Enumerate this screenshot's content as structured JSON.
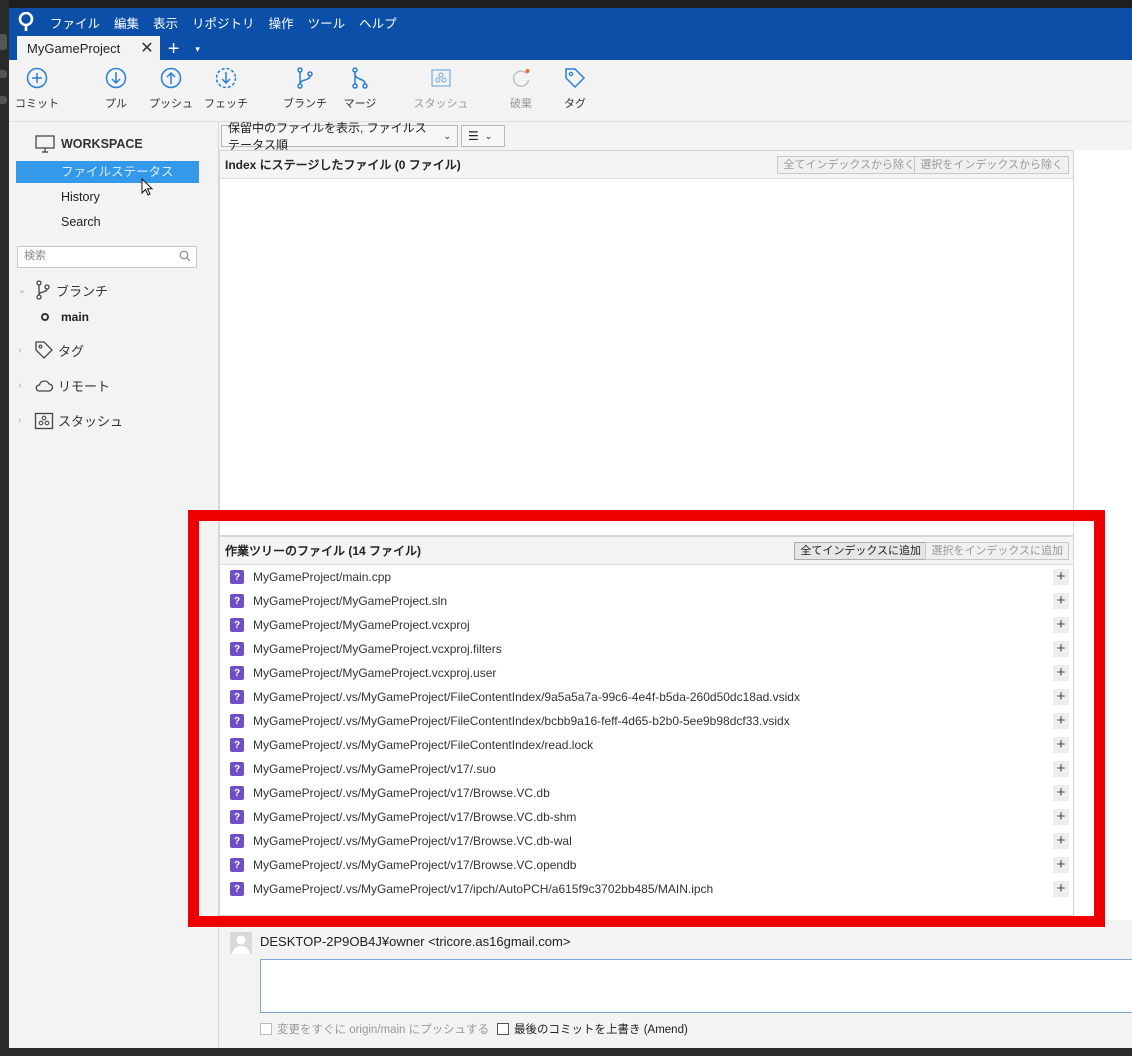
{
  "menubar": {
    "items": [
      "ファイル",
      "編集",
      "表示",
      "リポジトリ",
      "操作",
      "ツール",
      "ヘルプ"
    ]
  },
  "tabbar": {
    "tab_label": "MyGameProject",
    "close_glyph": "✕",
    "plus_glyph": "+",
    "caret_glyph": "▾"
  },
  "toolbar": {
    "commit": "コミット",
    "pull": "プル",
    "push": "プッシュ",
    "fetch": "フェッチ",
    "branch": "ブランチ",
    "merge": "マージ",
    "stash": "スタッシュ",
    "discard": "破棄",
    "tag": "タグ"
  },
  "sidebar": {
    "workspace": "WORKSPACE",
    "nav": [
      "ファイルステータス",
      "History",
      "Search"
    ],
    "search_placeholder": "検索",
    "branches": "ブランチ",
    "main_branch": "main",
    "tags": "タグ",
    "remotes": "リモート",
    "stashes": "スタッシュ"
  },
  "filterbar": {
    "dropdown": "保留中のファイルを表示, ファイルステータス順",
    "view_glyph": "☰"
  },
  "staged": {
    "title": "Index にステージしたファイル   (0 ファイル)",
    "remove_all": "全てインデックスから除く",
    "remove_selected": "選択をインデックスから除く"
  },
  "unstaged": {
    "title": "作業ツリーのファイル   (14 ファイル)",
    "add_all": "全てインデックスに追加",
    "add_selected": "選択をインデックスに追加",
    "files": [
      "MyGameProject/main.cpp",
      "MyGameProject/MyGameProject.sln",
      "MyGameProject/MyGameProject.vcxproj",
      "MyGameProject/MyGameProject.vcxproj.filters",
      "MyGameProject/MyGameProject.vcxproj.user",
      "MyGameProject/.vs/MyGameProject/FileContentIndex/9a5a5a7a-99c6-4e4f-b5da-260d50dc18ad.vsidx",
      "MyGameProject/.vs/MyGameProject/FileContentIndex/bcbb9a16-feff-4d65-b2b0-5ee9b98dcf33.vsidx",
      "MyGameProject/.vs/MyGameProject/FileContentIndex/read.lock",
      "MyGameProject/.vs/MyGameProject/v17/.suo",
      "MyGameProject/.vs/MyGameProject/v17/Browse.VC.db",
      "MyGameProject/.vs/MyGameProject/v17/Browse.VC.db-shm",
      "MyGameProject/.vs/MyGameProject/v17/Browse.VC.db-wal",
      "MyGameProject/.vs/MyGameProject/v17/Browse.VC.opendb",
      "MyGameProject/.vs/MyGameProject/v17/ipch/AutoPCH/a615f9c3702bb485/MAIN.ipch"
    ],
    "status_glyph": "?",
    "add_glyph": "+"
  },
  "commit": {
    "author": "DESKTOP-2P9OB4J¥owner <tricore.as16gmail.com>",
    "push_option": "変更をすぐに origin/main にプッシュする",
    "amend_option": "最後のコミットを上書き (Amend)"
  },
  "colors": {
    "menubar": "#0b4fa8",
    "selection": "#3399e8",
    "status_icon": "#6f4fc7",
    "highlight": "#ee0000"
  }
}
